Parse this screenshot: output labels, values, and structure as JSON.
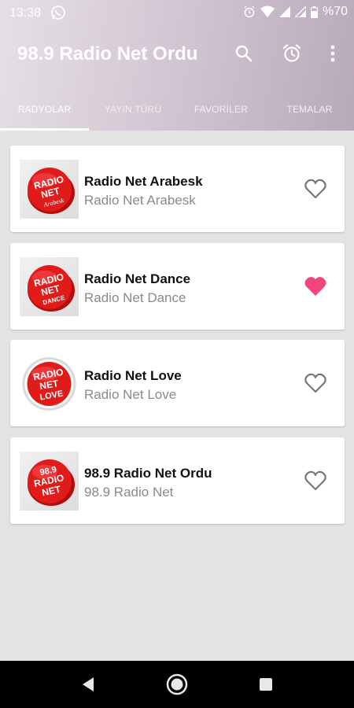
{
  "status_bar": {
    "time": "13:38",
    "battery": "%70",
    "icons": [
      "whatsapp-icon",
      "alarm-icon",
      "wifi-icon",
      "signal-icon",
      "battery-icon"
    ]
  },
  "app_bar": {
    "title": "98.9 Radio Net Ordu",
    "actions": [
      "search-icon",
      "alarm-clock-icon",
      "more-vert-icon"
    ]
  },
  "tabs": [
    {
      "label": "RADYOLAR",
      "active": true
    },
    {
      "label": "YAYIN TÜRÜ",
      "active": false
    },
    {
      "label": "FAVORİLER",
      "active": false
    },
    {
      "label": "TEMALAR",
      "active": false
    }
  ],
  "stations": [
    {
      "name": "Radio Net Arabesk",
      "subtitle": "Radio Net Arabesk",
      "logo": [
        "RADIO",
        "NET",
        "Arabesk"
      ],
      "favorite": false
    },
    {
      "name": "Radio Net Dance",
      "subtitle": "Radio Net Dance",
      "logo": [
        "RADIO",
        "NET",
        "DANCE"
      ],
      "favorite": true
    },
    {
      "name": "Radio Net Love",
      "subtitle": "Radio Net Love",
      "logo": [
        "RADIO",
        "NET",
        "LOVE"
      ],
      "favorite": false
    },
    {
      "name": "98.9 Radio Net Ordu",
      "subtitle": "98.9 Radio Net",
      "logo": [
        "98.9",
        "RADIO",
        "NET"
      ],
      "favorite": false
    }
  ],
  "colors": {
    "header_gradient": [
      "#e6e0e6",
      "#b8a9b8"
    ],
    "favorite_active": "#f0467c",
    "favorite_inactive": "#777777",
    "logo_red": "#e11a1a"
  },
  "nav_bar": [
    "back-icon",
    "home-icon",
    "recents-icon"
  ]
}
